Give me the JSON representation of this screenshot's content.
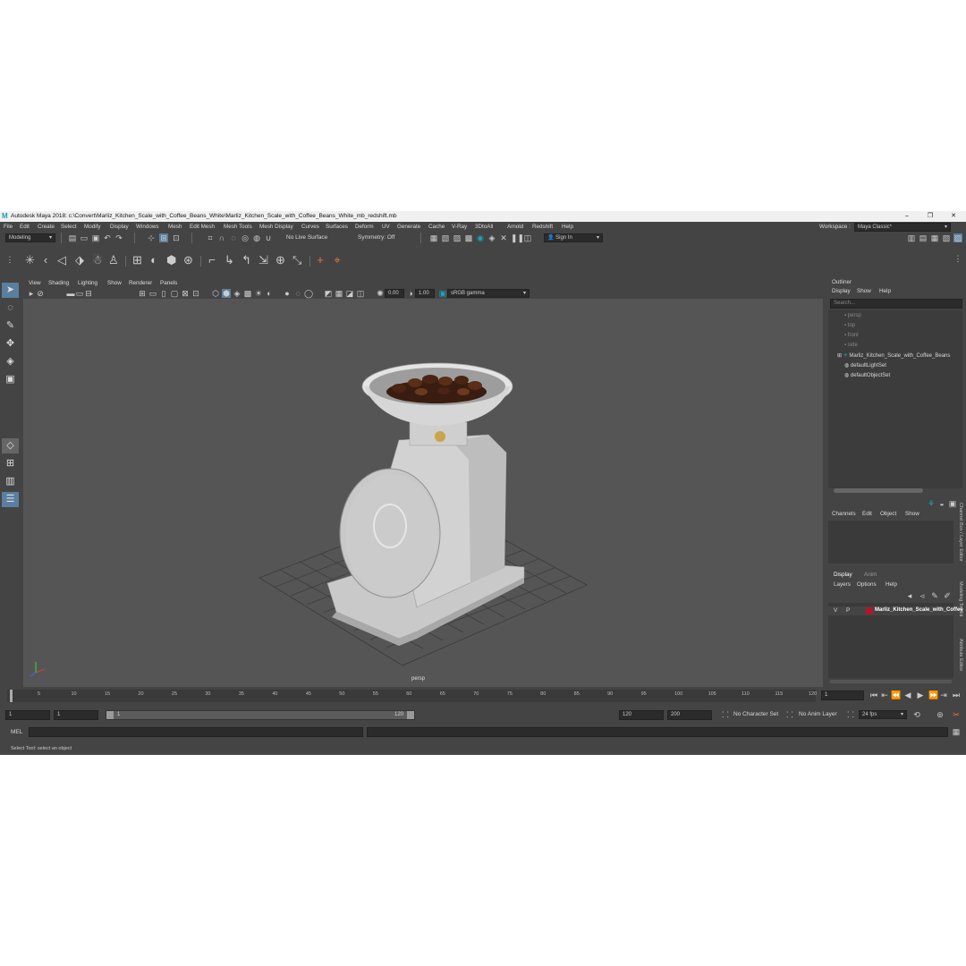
{
  "window": {
    "title": "Autodesk Maya 2018: c:\\Convert\\Marliz_Kitchen_Scale_with_Coffee_Beans_White\\Marliz_Kitchen_Scale_with_Coffee_Beans_White_mb_redshift.mb",
    "logo": "M",
    "minimize": "–",
    "maximize": "❐",
    "close": "✕"
  },
  "menubar": {
    "items": [
      "File",
      "Edit",
      "Create",
      "Select",
      "Modify",
      "Display",
      "Windows",
      "Mesh",
      "Edit Mesh",
      "Mesh Tools",
      "Mesh Display",
      "Curves",
      "Surfaces",
      "Deform",
      "UV",
      "Generate",
      "Cache",
      "V-Ray",
      "3DtoAll",
      "Arnold",
      "Redshift",
      "Help"
    ],
    "workspace_label": "Workspace :",
    "workspace_value": "Maya Classic*"
  },
  "status_line": {
    "mode": "Modeling",
    "live_surface": "No Live Surface",
    "symmetry": "Symmetry: Off",
    "sign_in": "Sign In"
  },
  "viewport": {
    "menus": [
      "View",
      "Shading",
      "Lighting",
      "Show",
      "Renderer",
      "Panels"
    ],
    "exposure": "0.00",
    "gamma": "1.00",
    "color_space": "sRGB gamma",
    "camera_label": "persp"
  },
  "outliner": {
    "title": "Outliner",
    "menus": [
      "Display",
      "Show",
      "Help"
    ],
    "search_placeholder": "Search...",
    "items": [
      "persp",
      "top",
      "front",
      "side",
      "Marliz_Kitchen_Scale_with_Coffee_Beans",
      "defaultLightSet",
      "defaultObjectSet"
    ]
  },
  "channel_box": {
    "menus": [
      "Channels",
      "Edit",
      "Object",
      "Show"
    ],
    "tabs": [
      "Display",
      "Anim"
    ],
    "layer_menus": [
      "Layers",
      "Options",
      "Help"
    ],
    "layer": {
      "v": "V",
      "p": "P",
      "name": "Marliz_Kitchen_Scale_with_Coffee"
    },
    "layer_color": "#b0182a",
    "side_tabs": [
      "Channel Box / Layer Editor",
      "Modeling Toolkit",
      "Attribute Editor"
    ]
  },
  "timeline": {
    "ticks": [
      "1",
      "5",
      "10",
      "15",
      "20",
      "25",
      "30",
      "35",
      "40",
      "45",
      "50",
      "55",
      "60",
      "65",
      "70",
      "75",
      "80",
      "85",
      "90",
      "95",
      "100",
      "105",
      "110",
      "115",
      "120"
    ],
    "current_frame": "1"
  },
  "range": {
    "start": "1",
    "playback_start": "1",
    "slider_start": "1",
    "slider_end": "120",
    "playback_end": "120",
    "end": "200",
    "character_set": "No Character Set",
    "anim_layer": "No Anim Layer",
    "fps": "24 fps"
  },
  "command_line": {
    "language": "MEL"
  },
  "help_line": {
    "text": "Select Tool: select an object"
  },
  "colors": {
    "accent": "#19a2b8",
    "panel": "#444444",
    "viewport_bg": "#555555"
  }
}
